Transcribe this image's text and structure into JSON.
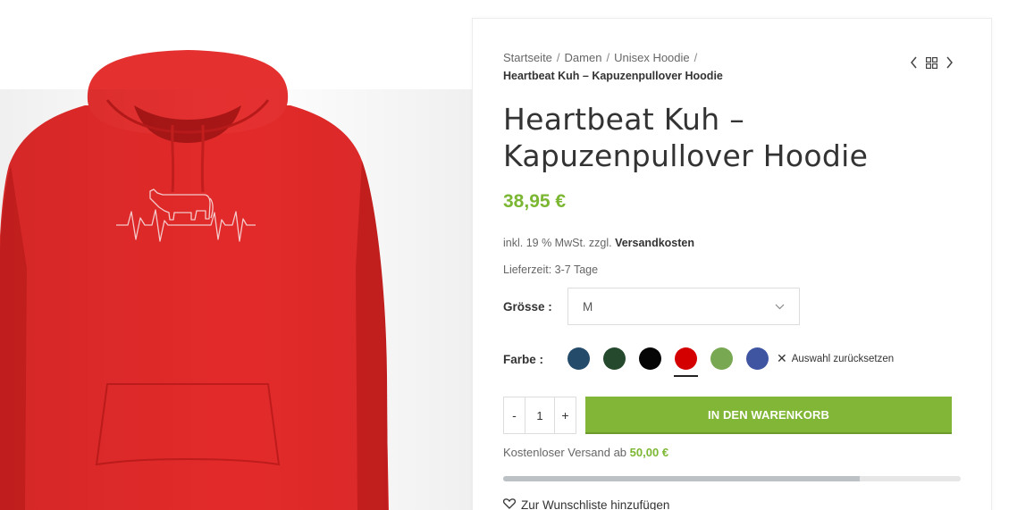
{
  "breadcrumb": {
    "items": [
      "Startseite",
      "Damen",
      "Unisex Hoodie"
    ],
    "separator": "/",
    "current": "Heartbeat Kuh – Kapuzenpullover Hoodie"
  },
  "product_nav": {
    "prev_icon": "chevron-left-icon",
    "grid_icon": "grid-icon",
    "next_icon": "chevron-right-icon"
  },
  "product": {
    "title": "Heartbeat Kuh – Kapuzenpullover Hoodie",
    "price": "38,95 €",
    "tax_prefix": "inkl. 19 % MwSt. zzgl.",
    "tax_link": "Versandkosten",
    "delivery": "Lieferzeit: 3-7 Tage",
    "image_color": "#e32a2a"
  },
  "size": {
    "label": "Grösse :",
    "selected": "M"
  },
  "color": {
    "label": "Farbe :",
    "swatches": [
      "#244b6a",
      "#25492c",
      "#050505",
      "#d40000",
      "#79a852",
      "#3f55a2"
    ],
    "selected_index": 3,
    "reset_label": "Auswahl zurücksetzen"
  },
  "cart": {
    "qty_minus": "-",
    "qty": "1",
    "qty_plus": "+",
    "button": "IN DEN WARENKORB"
  },
  "shipping": {
    "text": "Kostenloser Versand ab",
    "amount": "50,00 €",
    "progress": 0.78
  },
  "wishlist": {
    "label": "Zur Wunschliste hinzufügen"
  },
  "colors": {
    "accent": "#81b636",
    "price": "#7cb733"
  }
}
